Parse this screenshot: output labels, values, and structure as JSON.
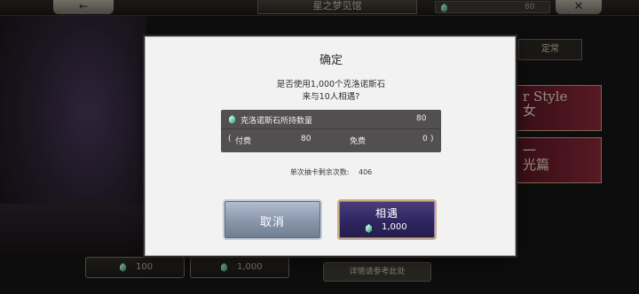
{
  "topbar": {
    "back_label": "←",
    "title": "星之梦见馆",
    "currency_value": "80",
    "close_label": "✕"
  },
  "background": {
    "right_tab_label": "定常",
    "banner_a_line1": "r Style",
    "banner_a_line2": "女",
    "banner_b_line1": "一",
    "banner_b_line2": "光篇",
    "bottom_left_1_value": "100",
    "bottom_left_2_value": "1,000",
    "detail_label": "详情请参考此处"
  },
  "dialog": {
    "title": "确定",
    "question_line1": "是否使用1,000个克洛诺斯石",
    "question_line2": "来与10人相遇?",
    "holdings_label": "克洛诺斯石所持数量",
    "holdings_value": "80",
    "paid_label": "付费",
    "paid_value": "80",
    "free_label": "免费",
    "free_value": "0",
    "remaining_label": "单次抽卡剩余次数:",
    "remaining_value": "406",
    "cancel_label": "取消",
    "confirm_label": "相遇",
    "confirm_cost": "1,000"
  },
  "colors": {
    "dialog_bg": "#f3f2f3",
    "info_box_bg": "#514f50",
    "cancel_button": "#8896ab",
    "confirm_button": "#2e2660",
    "gem_color": "#8fe0c0"
  },
  "icons": {
    "gem": "chronos-stone-icon"
  }
}
